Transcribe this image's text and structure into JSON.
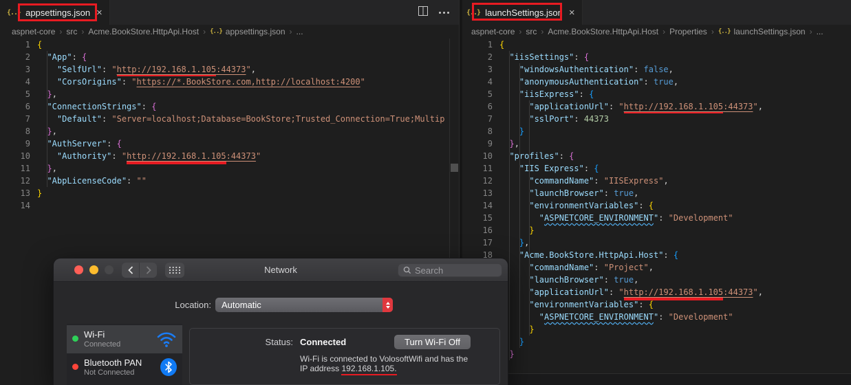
{
  "colors": {
    "annotation": "#e81b22",
    "json_icon": "#cbb23f",
    "red_underline": "#e81b22"
  },
  "icons": {
    "json_glyph": "{..}",
    "breadcrumb_sep": "›"
  },
  "editors": [
    {
      "tab": {
        "icon": "{..}",
        "label": "appsettings.json",
        "close": "×"
      },
      "breadcrumbs": [
        {
          "label": "aspnet-core"
        },
        {
          "label": "src"
        },
        {
          "label": "Acme.BookStore.HttpApi.Host"
        },
        {
          "label": "appsettings.json",
          "icon": true
        },
        {
          "label": "..."
        }
      ],
      "lines": [
        [
          {
            "c": "g",
            "t": "{"
          }
        ],
        [
          {
            "c": "p",
            "t": "  "
          },
          {
            "c": "k",
            "t": "\"App\""
          },
          {
            "c": "p",
            "t": ": "
          },
          {
            "c": "m",
            "t": "{"
          }
        ],
        [
          {
            "c": "p",
            "t": "    "
          },
          {
            "c": "k",
            "t": "\"SelfUrl\""
          },
          {
            "c": "p",
            "t": ": "
          },
          {
            "c": "s",
            "t": "\""
          },
          {
            "c": "s",
            "t": "http://192.168.1.105",
            "u": "link red"
          },
          {
            "c": "s",
            "t": ":44373",
            "u": "link"
          },
          {
            "c": "s",
            "t": "\""
          },
          {
            "c": "p",
            "t": ","
          }
        ],
        [
          {
            "c": "p",
            "t": "    "
          },
          {
            "c": "k",
            "t": "\"CorsOrigins\""
          },
          {
            "c": "p",
            "t": ": "
          },
          {
            "c": "s",
            "t": "\""
          },
          {
            "c": "s",
            "t": "https://*.BookStore.com,http://localhost:4200",
            "u": "link"
          },
          {
            "c": "s",
            "t": "\""
          }
        ],
        [
          {
            "c": "p",
            "t": "  "
          },
          {
            "c": "m",
            "t": "}"
          },
          {
            "c": "p",
            "t": ","
          }
        ],
        [
          {
            "c": "p",
            "t": "  "
          },
          {
            "c": "k",
            "t": "\"ConnectionStrings\""
          },
          {
            "c": "p",
            "t": ": "
          },
          {
            "c": "m",
            "t": "{"
          }
        ],
        [
          {
            "c": "p",
            "t": "    "
          },
          {
            "c": "k",
            "t": "\"Default\""
          },
          {
            "c": "p",
            "t": ": "
          },
          {
            "c": "s",
            "t": "\"Server=localhost;Database=BookStore;Trusted_Connection=True;Multip"
          }
        ],
        [
          {
            "c": "p",
            "t": "  "
          },
          {
            "c": "m",
            "t": "}"
          },
          {
            "c": "p",
            "t": ","
          }
        ],
        [
          {
            "c": "p",
            "t": "  "
          },
          {
            "c": "k",
            "t": "\"AuthServer\""
          },
          {
            "c": "p",
            "t": ": "
          },
          {
            "c": "m",
            "t": "{"
          }
        ],
        [
          {
            "c": "p",
            "t": "    "
          },
          {
            "c": "k",
            "t": "\"Authority\""
          },
          {
            "c": "p",
            "t": ": "
          },
          {
            "c": "s",
            "t": "\""
          },
          {
            "c": "s",
            "t": "http://192.168.1.105",
            "u": "link redthick"
          },
          {
            "c": "s",
            "t": ":44373",
            "u": "link"
          },
          {
            "c": "s",
            "t": "\""
          }
        ],
        [
          {
            "c": "p",
            "t": "  "
          },
          {
            "c": "m",
            "t": "}"
          },
          {
            "c": "p",
            "t": ","
          }
        ],
        [
          {
            "c": "p",
            "t": "  "
          },
          {
            "c": "k",
            "t": "\"AbpLicenseCode\""
          },
          {
            "c": "p",
            "t": ": "
          },
          {
            "c": "s",
            "t": "\"\""
          }
        ],
        [
          {
            "c": "g",
            "t": "}"
          }
        ],
        []
      ]
    },
    {
      "tab": {
        "icon": "{..}",
        "label": "launchSettings.json",
        "close": "×"
      },
      "breadcrumbs": [
        {
          "label": "aspnet-core"
        },
        {
          "label": "src"
        },
        {
          "label": "Acme.BookStore.HttpApi.Host"
        },
        {
          "label": "Properties"
        },
        {
          "label": "launchSettings.json",
          "icon": true
        },
        {
          "label": "..."
        }
      ],
      "lines": [
        [
          {
            "c": "g",
            "t": "{"
          }
        ],
        [
          {
            "c": "p",
            "t": "  "
          },
          {
            "c": "k",
            "t": "\"iisSettings\""
          },
          {
            "c": "p",
            "t": ": "
          },
          {
            "c": "m",
            "t": "{"
          }
        ],
        [
          {
            "c": "p",
            "t": "    "
          },
          {
            "c": "k",
            "t": "\"windowsAuthentication\""
          },
          {
            "c": "p",
            "t": ": "
          },
          {
            "c": "b",
            "t": "false"
          },
          {
            "c": "p",
            "t": ","
          }
        ],
        [
          {
            "c": "p",
            "t": "    "
          },
          {
            "c": "k",
            "t": "\"anonymousAuthentication\""
          },
          {
            "c": "p",
            "t": ": "
          },
          {
            "c": "b",
            "t": "true"
          },
          {
            "c": "p",
            "t": ","
          }
        ],
        [
          {
            "c": "p",
            "t": "    "
          },
          {
            "c": "k",
            "t": "\"iisExpress\""
          },
          {
            "c": "p",
            "t": ": "
          },
          {
            "c": "u",
            "t": "{"
          }
        ],
        [
          {
            "c": "p",
            "t": "      "
          },
          {
            "c": "k",
            "t": "\"applicationUrl\""
          },
          {
            "c": "p",
            "t": ": "
          },
          {
            "c": "s",
            "t": "\""
          },
          {
            "c": "s",
            "t": "http://192.168.1.105",
            "u": "link red"
          },
          {
            "c": "s",
            "t": ":44373",
            "u": "link"
          },
          {
            "c": "s",
            "t": "\""
          },
          {
            "c": "p",
            "t": ","
          }
        ],
        [
          {
            "c": "p",
            "t": "      "
          },
          {
            "c": "k",
            "t": "\"sslPort\""
          },
          {
            "c": "p",
            "t": ": "
          },
          {
            "c": "n",
            "t": "44373"
          }
        ],
        [
          {
            "c": "p",
            "t": "    "
          },
          {
            "c": "u",
            "t": "}"
          }
        ],
        [
          {
            "c": "p",
            "t": "  "
          },
          {
            "c": "m",
            "t": "}"
          },
          {
            "c": "p",
            "t": ","
          }
        ],
        [
          {
            "c": "p",
            "t": "  "
          },
          {
            "c": "k",
            "t": "\"profiles\""
          },
          {
            "c": "p",
            "t": ": "
          },
          {
            "c": "m",
            "t": "{"
          }
        ],
        [
          {
            "c": "p",
            "t": "    "
          },
          {
            "c": "k",
            "t": "\"IIS Express\""
          },
          {
            "c": "p",
            "t": ": "
          },
          {
            "c": "u",
            "t": "{"
          }
        ],
        [
          {
            "c": "p",
            "t": "      "
          },
          {
            "c": "k",
            "t": "\"commandName\""
          },
          {
            "c": "p",
            "t": ": "
          },
          {
            "c": "s",
            "t": "\"IISExpress\""
          },
          {
            "c": "p",
            "t": ","
          }
        ],
        [
          {
            "c": "p",
            "t": "      "
          },
          {
            "c": "k",
            "t": "\"launchBrowser\""
          },
          {
            "c": "p",
            "t": ": "
          },
          {
            "c": "b",
            "t": "true"
          },
          {
            "c": "p",
            "t": ","
          }
        ],
        [
          {
            "c": "p",
            "t": "      "
          },
          {
            "c": "k",
            "t": "\"environmentVariables\""
          },
          {
            "c": "p",
            "t": ": "
          },
          {
            "c": "g",
            "t": "{"
          }
        ],
        [
          {
            "c": "p",
            "t": "        "
          },
          {
            "c": "k",
            "t": "\""
          },
          {
            "c": "k",
            "t": "ASPNETCORE_ENVIRONMENT",
            "u": "sq"
          },
          {
            "c": "k",
            "t": "\""
          },
          {
            "c": "p",
            "t": ": "
          },
          {
            "c": "s",
            "t": "\"Development\""
          }
        ],
        [
          {
            "c": "p",
            "t": "      "
          },
          {
            "c": "g",
            "t": "}"
          }
        ],
        [
          {
            "c": "p",
            "t": "    "
          },
          {
            "c": "u",
            "t": "}"
          },
          {
            "c": "p",
            "t": ","
          }
        ],
        [
          {
            "c": "p",
            "t": "    "
          },
          {
            "c": "k",
            "t": "\"Acme.BookStore.HttpApi.Host\""
          },
          {
            "c": "p",
            "t": ": "
          },
          {
            "c": "u",
            "t": "{"
          }
        ],
        [
          {
            "c": "p",
            "t": "      "
          },
          {
            "c": "k",
            "t": "\"commandName\""
          },
          {
            "c": "p",
            "t": ": "
          },
          {
            "c": "s",
            "t": "\"Project\""
          },
          {
            "c": "p",
            "t": ","
          }
        ],
        [
          {
            "c": "p",
            "t": "      "
          },
          {
            "c": "k",
            "t": "\"launchBrowser\""
          },
          {
            "c": "p",
            "t": ": "
          },
          {
            "c": "b",
            "t": "true"
          },
          {
            "c": "p",
            "t": ","
          }
        ],
        [
          {
            "c": "p",
            "t": "      "
          },
          {
            "c": "k",
            "t": "\"applicationUrl\""
          },
          {
            "c": "p",
            "t": ": "
          },
          {
            "c": "s",
            "t": "\""
          },
          {
            "c": "s",
            "t": "http://192.168.1.105",
            "u": "link redthick"
          },
          {
            "c": "s",
            "t": ":44373",
            "u": "link"
          },
          {
            "c": "s",
            "t": "\""
          },
          {
            "c": "p",
            "t": ","
          }
        ],
        [
          {
            "c": "p",
            "t": "      "
          },
          {
            "c": "k",
            "t": "\"environmentVariables\""
          },
          {
            "c": "p",
            "t": ": "
          },
          {
            "c": "g",
            "t": "{"
          }
        ],
        [
          {
            "c": "p",
            "t": "        "
          },
          {
            "c": "k",
            "t": "\""
          },
          {
            "c": "k",
            "t": "ASPNETCORE_ENVIRONMENT",
            "u": "sq"
          },
          {
            "c": "k",
            "t": "\""
          },
          {
            "c": "p",
            "t": ": "
          },
          {
            "c": "s",
            "t": "\"Development\""
          }
        ],
        [
          {
            "c": "p",
            "t": "      "
          },
          {
            "c": "g",
            "t": "}"
          }
        ],
        [
          {
            "c": "p",
            "t": "    "
          },
          {
            "c": "u",
            "t": "}"
          }
        ],
        [
          {
            "c": "p",
            "t": "  "
          },
          {
            "c": "m",
            "t": "}"
          }
        ],
        [
          {
            "c": "g",
            "t": "}"
          }
        ]
      ]
    }
  ],
  "network": {
    "title": "Network",
    "search_placeholder": "Search",
    "location_label": "Location:",
    "location_value": "Automatic",
    "interfaces": [
      {
        "name": "Wi-Fi",
        "status": "Connected",
        "dot_color": "#2ed158"
      },
      {
        "name": "Bluetooth PAN",
        "status": "Not Connected",
        "dot_color": "#ff453a"
      }
    ],
    "status_label": "Status:",
    "status_value": "Connected",
    "turn_off_button": "Turn Wi-Fi Off",
    "info_line1": "Wi-Fi is connected to VolosoftWifi and has the",
    "info_prefix": "IP address ",
    "info_ip": "192.168.1.105."
  }
}
